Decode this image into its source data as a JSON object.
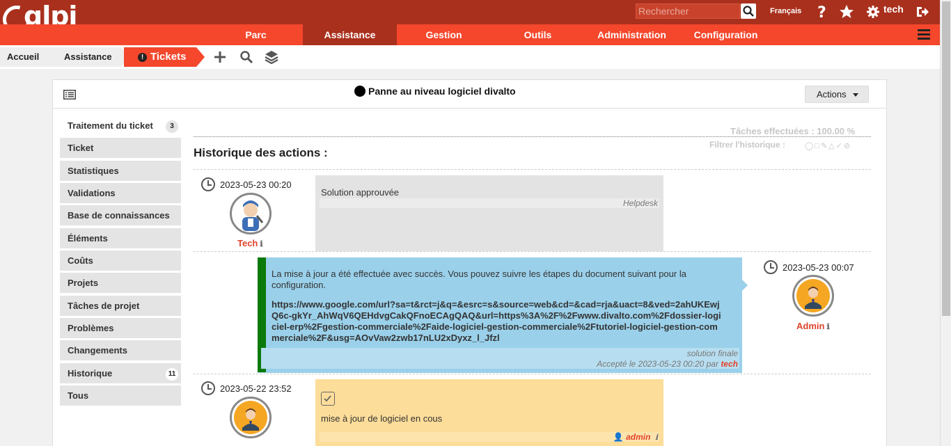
{
  "header": {
    "logo": "glpi",
    "search_placeholder": "Rechercher",
    "language": "Français",
    "user": "tech",
    "icons": [
      "search-icon",
      "help-icon",
      "star-icon",
      "gear-icon",
      "logout-icon"
    ]
  },
  "menu": {
    "items": [
      "Parc",
      "Assistance",
      "Gestion",
      "Outils",
      "Administration",
      "Configuration"
    ],
    "active": "Assistance"
  },
  "breadcrumb": {
    "home": "Accueil",
    "section": "Assistance",
    "current": "Tickets",
    "actions": [
      "add-icon",
      "search-icon",
      "layers-icon"
    ]
  },
  "ticket": {
    "title": "Panne au niveau logiciel divalto",
    "actions_label": "Actions"
  },
  "tabs": [
    {
      "label": "Traitement du ticket",
      "count": "3"
    },
    {
      "label": "Ticket"
    },
    {
      "label": "Statistiques"
    },
    {
      "label": "Validations"
    },
    {
      "label": "Base de connaissances"
    },
    {
      "label": "Éléments"
    },
    {
      "label": "Coûts"
    },
    {
      "label": "Projets"
    },
    {
      "label": "Tâches de projet"
    },
    {
      "label": "Problèmes"
    },
    {
      "label": "Changements"
    },
    {
      "label": "Historique",
      "count": "11"
    },
    {
      "label": "Tous"
    }
  ],
  "timeline": {
    "stats": "Tâches effectuées : 100.00 %",
    "filter_label": "Filtrer l'historique :",
    "title": "Historique des actions :",
    "entries": [
      {
        "date": "2023-05-23 00:20",
        "user": "Tech",
        "content": "Solution approuvée",
        "footer": "Helpdesk"
      },
      {
        "date": "2023-05-23 00:07",
        "user": "Admin",
        "content": "La mise à jour a été effectuée avec succès. Vous pouvez suivre les étapes du document suivant pour la configuration.",
        "link": "https://www.google.com/url?sa=t&rct=j&q=&esrc=s&source=web&cd=&cad=rja&uact=8&ved=2ahUKEwjQ6c-gkYr_AhWqV6QEHdvgCakQFnoECAgQAQ&url=https%3A%2F%2Fwww.divalto.com%2Fdossier-logiciel-erp%2Fgestion-commerciale%2Faide-logiciel-gestion-commerciale%2Ftutoriel-logiciel-gestion-commerciale%2F&usg=AOvVaw2zwb17nLU2xDyxz_l_Jfzl",
        "footer_type": "solution finale",
        "footer_accepted": "Accepté le 2023-05-23 00:20 par",
        "footer_user": "tech"
      },
      {
        "date": "2023-05-22 23:52",
        "user": "admin",
        "content": "mise à jour de logiciel en cous"
      }
    ]
  },
  "colors": {
    "topbar": "#a9301d",
    "menubar": "#f4472c",
    "accent": "#e0432b",
    "solution": "#9ad0ea",
    "task": "#fddd9a",
    "followup": "#e3e3e3",
    "approved_bar": "#0b7a0b"
  }
}
